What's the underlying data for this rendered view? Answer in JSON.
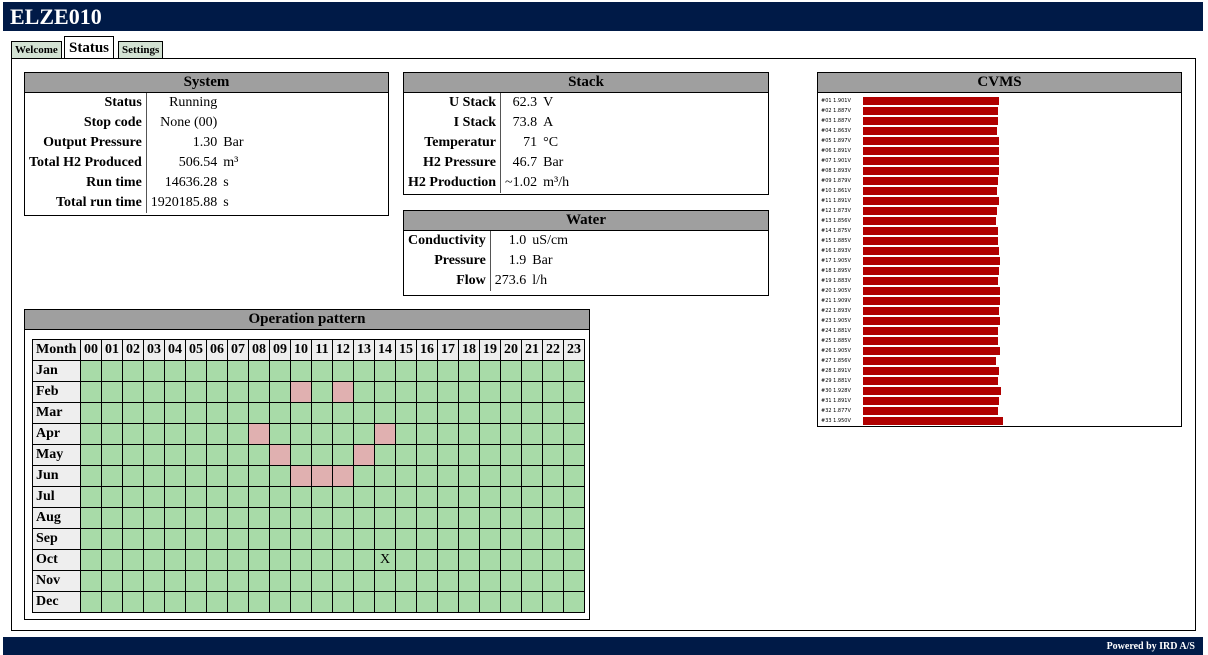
{
  "app": {
    "title": "ELZE010"
  },
  "tabs": [
    {
      "label": "Welcome",
      "active": false
    },
    {
      "label": "Status",
      "active": true
    },
    {
      "label": "Settings",
      "active": false
    }
  ],
  "system": {
    "title": "System",
    "rows": [
      {
        "label": "Status",
        "value": "Running",
        "unit": ""
      },
      {
        "label": "Stop code",
        "value": "None (00)",
        "unit": ""
      },
      {
        "label": "Output Pressure",
        "value": "1.30",
        "unit": "Bar"
      },
      {
        "label": "Total H2 Produced",
        "value": "506.54",
        "unit": "m³"
      },
      {
        "label": "Run time",
        "value": "14636.28",
        "unit": "s"
      },
      {
        "label": "Total run time",
        "value": "1920185.88",
        "unit": "s"
      }
    ]
  },
  "stack": {
    "title": "Stack",
    "rows": [
      {
        "label": "U Stack",
        "value": "62.3",
        "unit": "V"
      },
      {
        "label": "I Stack",
        "value": "73.8",
        "unit": "A"
      },
      {
        "label": "Temperatur",
        "value": "71",
        "unit": "°C"
      },
      {
        "label": "H2 Pressure",
        "value": "46.7",
        "unit": "Bar"
      },
      {
        "label": "H2 Production",
        "value": "~1.02",
        "unit": "m³/h"
      }
    ]
  },
  "water": {
    "title": "Water",
    "rows": [
      {
        "label": "Conductivity",
        "value": "1.0",
        "unit": "uS/cm"
      },
      {
        "label": "Pressure",
        "value": "1.9",
        "unit": "Bar"
      },
      {
        "label": "Flow",
        "value": "273.6",
        "unit": "l/h"
      }
    ]
  },
  "operation": {
    "title": "Operation pattern",
    "month_header": "Month",
    "hours": [
      "00",
      "01",
      "02",
      "03",
      "04",
      "05",
      "06",
      "07",
      "08",
      "09",
      "10",
      "11",
      "12",
      "13",
      "14",
      "15",
      "16",
      "17",
      "18",
      "19",
      "20",
      "21",
      "22",
      "23"
    ],
    "months": [
      "Jan",
      "Feb",
      "Mar",
      "Apr",
      "May",
      "Jun",
      "Jul",
      "Aug",
      "Sep",
      "Oct",
      "Nov",
      "Dec"
    ],
    "highlighted": [
      [
        1,
        10
      ],
      [
        1,
        12
      ],
      [
        3,
        8
      ],
      [
        3,
        14
      ],
      [
        4,
        9
      ],
      [
        4,
        13
      ],
      [
        5,
        10
      ],
      [
        5,
        11
      ],
      [
        5,
        12
      ]
    ],
    "marks": [
      {
        "month": 9,
        "hour": 14,
        "text": "X"
      }
    ],
    "colors": {
      "normal": "#a8dba8",
      "highlight": "#e0b0b0"
    }
  },
  "cvms": {
    "title": "CVMS",
    "bar_color": "#b00000",
    "cells": [
      {
        "label": "#01 1.901V",
        "voltage": 1.901
      },
      {
        "label": "#02 1.887V",
        "voltage": 1.887
      },
      {
        "label": "#03 1.887V",
        "voltage": 1.887
      },
      {
        "label": "#04 1.863V",
        "voltage": 1.863
      },
      {
        "label": "#05 1.897V",
        "voltage": 1.897
      },
      {
        "label": "#06 1.891V",
        "voltage": 1.891
      },
      {
        "label": "#07 1.901V",
        "voltage": 1.901
      },
      {
        "label": "#08 1.893V",
        "voltage": 1.893
      },
      {
        "label": "#09 1.879V",
        "voltage": 1.879
      },
      {
        "label": "#10 1.861V",
        "voltage": 1.861
      },
      {
        "label": "#11 1.891V",
        "voltage": 1.891
      },
      {
        "label": "#12 1.873V",
        "voltage": 1.873
      },
      {
        "label": "#13 1.856V",
        "voltage": 1.856
      },
      {
        "label": "#14 1.875V",
        "voltage": 1.875
      },
      {
        "label": "#15 1.885V",
        "voltage": 1.885
      },
      {
        "label": "#16 1.893V",
        "voltage": 1.893
      },
      {
        "label": "#17 1.905V",
        "voltage": 1.905
      },
      {
        "label": "#18 1.895V",
        "voltage": 1.895
      },
      {
        "label": "#19 1.883V",
        "voltage": 1.883
      },
      {
        "label": "#20 1.905V",
        "voltage": 1.905
      },
      {
        "label": "#21 1.909V",
        "voltage": 1.909
      },
      {
        "label": "#22 1.893V",
        "voltage": 1.893
      },
      {
        "label": "#23 1.905V",
        "voltage": 1.905
      },
      {
        "label": "#24 1.881V",
        "voltage": 1.881
      },
      {
        "label": "#25 1.885V",
        "voltage": 1.885
      },
      {
        "label": "#26 1.905V",
        "voltage": 1.905
      },
      {
        "label": "#27 1.856V",
        "voltage": 1.856
      },
      {
        "label": "#28 1.891V",
        "voltage": 1.891
      },
      {
        "label": "#29 1.881V",
        "voltage": 1.881
      },
      {
        "label": "#30 1.928V",
        "voltage": 1.928
      },
      {
        "label": "#31 1.891V",
        "voltage": 1.891
      },
      {
        "label": "#32 1.877V",
        "voltage": 1.877
      },
      {
        "label": "#33 1.950V",
        "voltage": 1.95
      }
    ]
  },
  "footer": {
    "text": "Powered by IRD A/S"
  }
}
